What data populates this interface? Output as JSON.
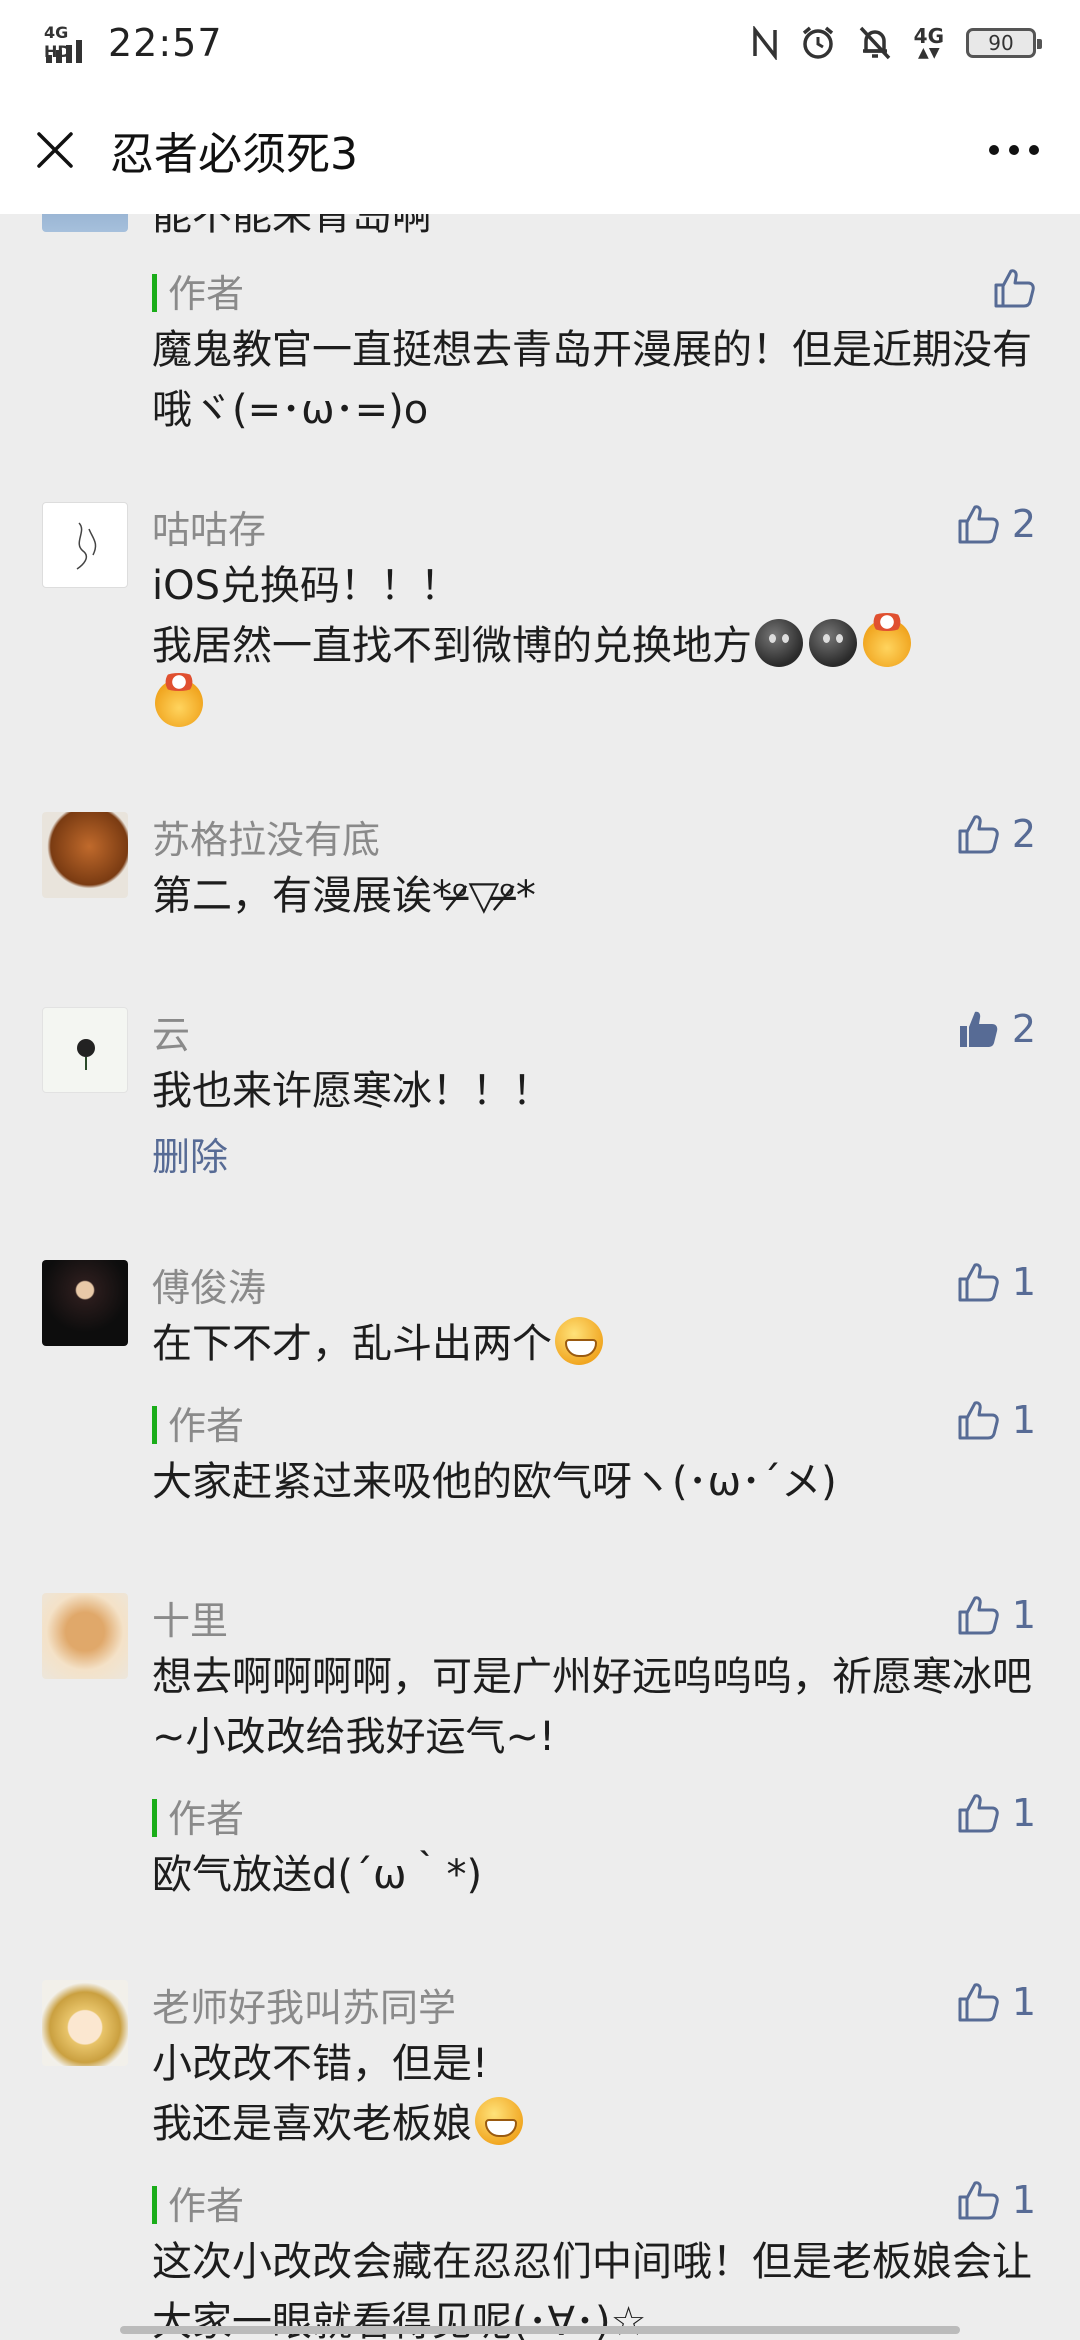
{
  "status_bar": {
    "network": "4G HD",
    "time": "22:57",
    "network_right": "4G",
    "battery": "90"
  },
  "title_bar": {
    "title": "忍者必须死3"
  },
  "comments": [
    {
      "id": "c0",
      "text": "能不能来青岛啊",
      "replies": [
        {
          "author": "作者",
          "text": "魔鬼教官一直挺想去青岛开漫展的！但是近期没有哦ヾ(=･ω･=)o",
          "likes": ""
        }
      ]
    },
    {
      "id": "c1",
      "name": "咕咕存",
      "likes": "2",
      "text_line1": "iOS兑换码！！！",
      "text_line2": "我居然一直找不到微博的兑换地方"
    },
    {
      "id": "c2",
      "name": "苏格拉没有底",
      "likes": "2",
      "text": "第二，有漫展诶*ᵒ̶̷▽ᵒ̶̷*"
    },
    {
      "id": "c3",
      "name": "云",
      "likes": "2",
      "text": "我也来许愿寒冰！！！",
      "delete_label": "删除"
    },
    {
      "id": "c4",
      "name": "傅俊涛",
      "likes": "1",
      "text": "在下不才，乱斗出两个",
      "reply": {
        "author": "作者",
        "likes": "1",
        "text": "大家赶紧过来吸他的欧气呀ヽ(･ω･´メ)"
      }
    },
    {
      "id": "c5",
      "name": "十里",
      "likes": "1",
      "text": "想去啊啊啊啊，可是广州好远呜呜呜，祈愿寒冰吧~小改改给我好运气~!",
      "reply": {
        "author": "作者",
        "likes": "1",
        "text": "欧气放送d(´ω｀*)"
      }
    },
    {
      "id": "c6",
      "name": "老师好我叫苏同学",
      "likes": "1",
      "text_line1": "小改改不错，但是!",
      "text_line2": "我还是喜欢老板娘",
      "reply": {
        "author": "作者",
        "likes": "1",
        "text": "这次小改改会藏在忍忍们中间哦！但是老板娘会让大家一眼就看得见呢(･∀･)☆"
      }
    }
  ],
  "colors": {
    "background": "#ededed",
    "link": "#576b95",
    "author_bar": "#1aad19"
  }
}
